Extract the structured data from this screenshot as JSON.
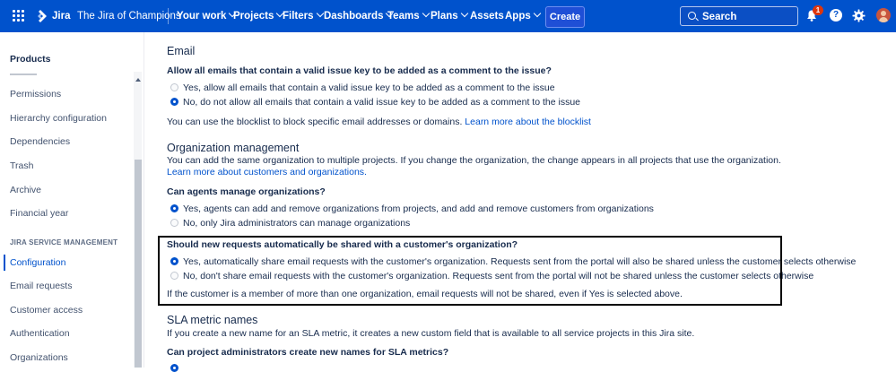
{
  "topnav": {
    "brand": "Jira",
    "project": "The Jira of Champions",
    "items": [
      "Your work",
      "Projects",
      "Filters",
      "Dashboards",
      "Teams",
      "Plans",
      "Assets",
      "Apps"
    ],
    "create_label": "Create",
    "search_placeholder": "Search",
    "notifications_count": "1",
    "help_label": "?"
  },
  "sidebar": {
    "title": "Products",
    "items": [
      "Permissions",
      "Hierarchy configuration",
      "Dependencies",
      "Trash",
      "Archive",
      "Financial year"
    ],
    "section": "JIRA SERVICE MANAGEMENT",
    "jsm_items": [
      "Configuration",
      "Email requests",
      "Customer access",
      "Authentication",
      "Organizations"
    ],
    "active": "Configuration"
  },
  "main": {
    "email": {
      "heading": "Email",
      "question": "Allow all emails that contain a valid issue key to be added as a comment to the issue?",
      "options": [
        {
          "label": "Yes, allow all emails that contain a valid issue key to be added as a comment to the issue",
          "selected": false
        },
        {
          "label": "No, do not allow all emails that contain a valid issue key to be added as a comment to the issue",
          "selected": true
        }
      ],
      "note": "You can use the blocklist to block specific email addresses or domains.",
      "note_link": "Learn more about the blocklist"
    },
    "org": {
      "heading": "Organization management",
      "desc": "You can add the same organization to multiple projects. If you change the organization, the change appears in all projects that use the organization.",
      "link": "Learn more about customers and organizations.",
      "question": "Can agents manage organizations?",
      "options": [
        {
          "label": "Yes, agents can add and remove organizations from projects, and add and remove customers from organizations",
          "selected": true
        },
        {
          "label": "No, only Jira administrators can manage organizations",
          "selected": false
        }
      ]
    },
    "share": {
      "question": "Should new requests automatically be shared with a customer's organization?",
      "options": [
        {
          "label": "Yes, automatically share email requests with the customer's organization. Requests sent from the portal will also be shared unless the customer selects otherwise",
          "selected": true
        },
        {
          "label": "No, don't share email requests with the customer's organization. Requests sent from the portal will not be shared unless the customer selects otherwise",
          "selected": false
        }
      ],
      "note": "If the customer is a member of more than one organization, email requests will not be shared, even if Yes is selected above."
    },
    "sla": {
      "heading": "SLA metric names",
      "desc": "If you create a new name for an SLA metric, it creates a new custom field that is available to all service projects in this Jira site.",
      "question": "Can project administrators create new names for SLA metrics?"
    }
  }
}
